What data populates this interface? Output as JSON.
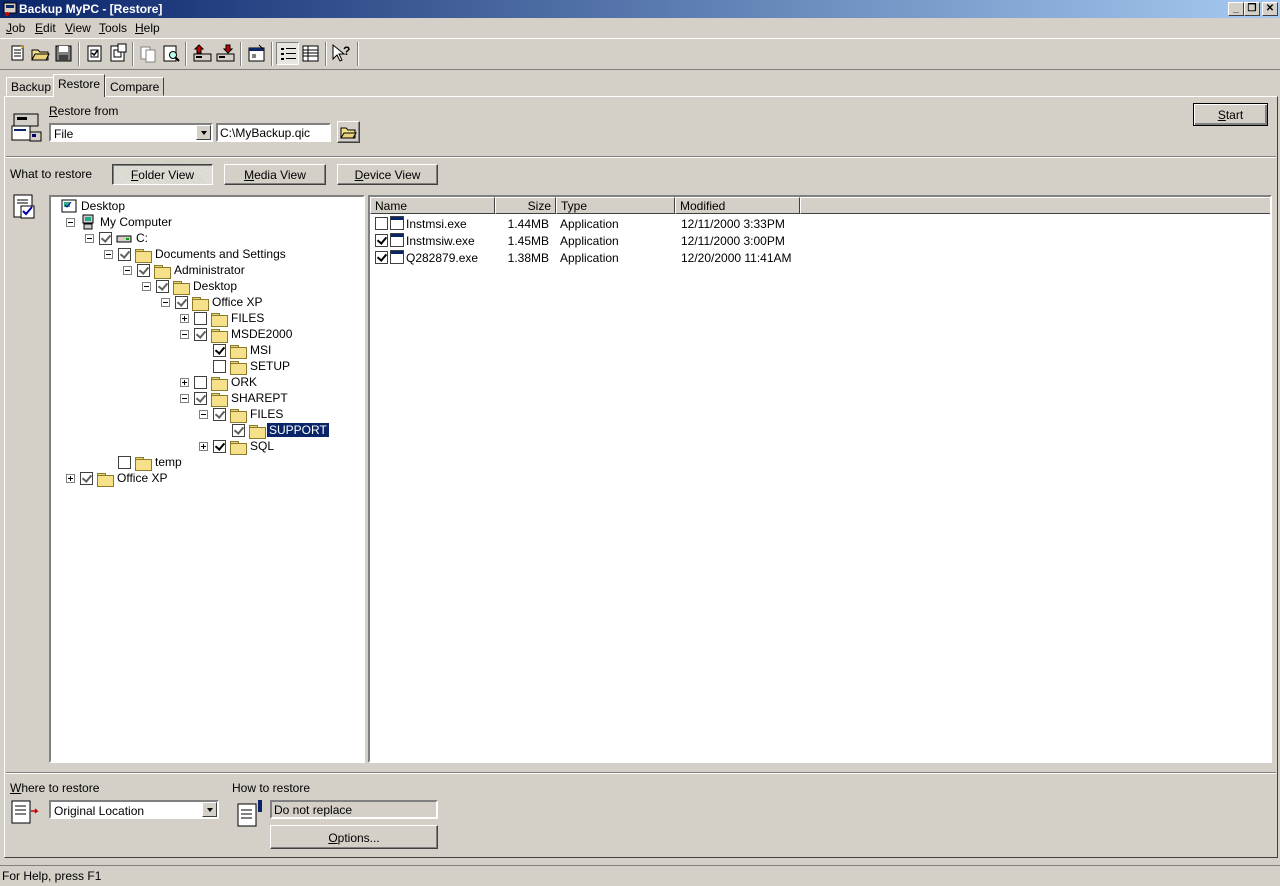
{
  "window": {
    "title": "Backup MyPC - [Restore]"
  },
  "menu": [
    {
      "key": "J",
      "rest": "ob"
    },
    {
      "key": "E",
      "rest": "dit"
    },
    {
      "key": "V",
      "rest": "iew"
    },
    {
      "key": "T",
      "rest": "ools"
    },
    {
      "key": "H",
      "rest": "elp"
    }
  ],
  "toolbar": {
    "buttons": [
      "new-job",
      "open-job",
      "save-job",
      "select-all",
      "deselect",
      "copy",
      "find",
      "start-backup",
      "start-restore",
      "properties",
      "details-view",
      "list-view",
      "help-pointer"
    ]
  },
  "tabs": [
    "Backup",
    "Restore",
    "Compare"
  ],
  "active_tab": "Restore",
  "restore_from": {
    "label_key": "R",
    "label_rest": "estore from",
    "source_type": "File",
    "path": "C:\\MyBackup.qic"
  },
  "start_button": {
    "key": "S",
    "rest": "tart"
  },
  "what_to_restore": {
    "label": "What to restore",
    "views": [
      {
        "key": "F",
        "rest": "older View"
      },
      {
        "key": "M",
        "rest": "edia View"
      },
      {
        "key": "D",
        "rest": "evice View"
      }
    ]
  },
  "tree": [
    {
      "label": "Desktop",
      "level": 0,
      "type": "desktop",
      "checked": null,
      "expander": null
    },
    {
      "label": "My Computer",
      "level": 1,
      "type": "computer",
      "checked": null,
      "expander": "minus"
    },
    {
      "label": "C:",
      "level": 2,
      "type": "drive",
      "checked": "gray",
      "expander": "minus"
    },
    {
      "label": "Documents and Settings",
      "level": 3,
      "type": "folder",
      "checked": "gray",
      "expander": "minus"
    },
    {
      "label": "Administrator",
      "level": 4,
      "type": "folder",
      "checked": "gray",
      "expander": "minus"
    },
    {
      "label": "Desktop",
      "level": 5,
      "type": "folder",
      "checked": "gray",
      "expander": "minus"
    },
    {
      "label": "Office XP",
      "level": 6,
      "type": "folder",
      "checked": "gray",
      "expander": "minus"
    },
    {
      "label": "FILES",
      "level": 7,
      "type": "folder",
      "checked": "no",
      "expander": "plus"
    },
    {
      "label": "MSDE2000",
      "level": 7,
      "type": "folder",
      "checked": "gray",
      "expander": "minus"
    },
    {
      "label": "MSI",
      "level": 8,
      "type": "folder",
      "checked": "yes",
      "expander": null
    },
    {
      "label": "SETUP",
      "level": 8,
      "type": "folder",
      "checked": "no",
      "expander": null
    },
    {
      "label": "ORK",
      "level": 7,
      "type": "folder",
      "checked": "no",
      "expander": "plus"
    },
    {
      "label": "SHAREPT",
      "level": 7,
      "type": "folder",
      "checked": "gray",
      "expander": "minus"
    },
    {
      "label": "FILES",
      "level": 8,
      "type": "folder",
      "checked": "gray",
      "expander": "minus"
    },
    {
      "label": "SUPPORT",
      "level": 9,
      "type": "folder",
      "checked": "gray",
      "expander": null,
      "selected": true
    },
    {
      "label": "SQL",
      "level": 8,
      "type": "folder",
      "checked": "yes",
      "expander": "plus"
    },
    {
      "label": "temp",
      "level": 3,
      "type": "folder",
      "checked": "no",
      "expander": null
    },
    {
      "label": "Office XP",
      "level": 1,
      "type": "folder",
      "checked": "gray",
      "expander": "plus"
    }
  ],
  "file_list": {
    "columns": [
      "Name",
      "Size",
      "Type",
      "Modified"
    ],
    "rows": [
      {
        "checked": false,
        "name": "Instmsi.exe",
        "size": "1.44MB",
        "type": "Application",
        "modified": "12/11/2000 3:33PM"
      },
      {
        "checked": true,
        "name": "Instmsiw.exe",
        "size": "1.45MB",
        "type": "Application",
        "modified": "12/11/2000 3:00PM"
      },
      {
        "checked": true,
        "name": "Q282879.exe",
        "size": "1.38MB",
        "type": "Application",
        "modified": "12/20/2000 11:41AM"
      }
    ]
  },
  "where_to_restore": {
    "label_key": "W",
    "label_rest": "here to restore",
    "value": "Original Location"
  },
  "how_to_restore": {
    "label": "How to restore",
    "value": "Do not replace",
    "options_key": "O",
    "options_rest": "ptions..."
  },
  "status": "For Help, press F1"
}
